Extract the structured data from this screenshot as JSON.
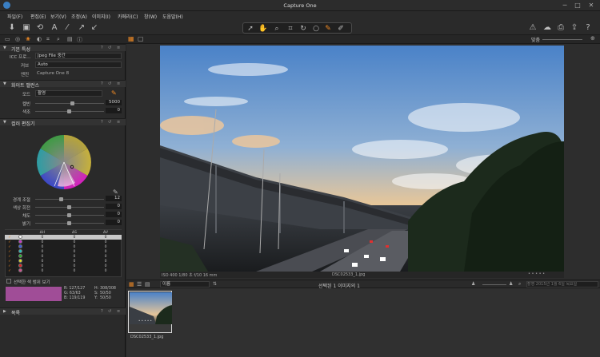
{
  "window": {
    "title": "Capture One",
    "min_glyph": "─",
    "max_glyph": "□",
    "close_glyph": "✕"
  },
  "menu": [
    "파일(F)",
    "편집(E)",
    "보기(V)",
    "조정(A)",
    "이미지(I)",
    "카메라(C)",
    "창(W)",
    "도움말(H)"
  ],
  "toolbar": {
    "fit_label": "맞춤"
  },
  "sections": {
    "basic": {
      "title": "기본 특성",
      "icc_label": "ICC 프로…",
      "icc_value": "Jpeg File 중간",
      "curve_label": "커브",
      "curve_value": "Auto",
      "engine_label": "엔진",
      "engine_value": "Capture One 8"
    },
    "wb": {
      "title": "화이트 밸런스",
      "mode_label": "모드",
      "mode_value": "촬영",
      "kelvin_label": "켈빈",
      "kelvin_value": "5000",
      "tint_label": "색조",
      "tint_value": "0"
    },
    "color_editor": {
      "title": "컬러 편집기",
      "smooth_label": "경계 조절",
      "smooth_value": "12",
      "hue_label": "색상 회전",
      "hue_value": "0",
      "sat_label": "채도",
      "sat_value": "0",
      "light_label": "밝기",
      "light_value": "0",
      "col_h": "ΔH",
      "col_s": "ΔS",
      "col_v": "ΔV",
      "rows": [
        {
          "color": "#ffffff",
          "h": "0",
          "s": "0",
          "v": "0"
        },
        {
          "color": "#c833c8",
          "h": "0",
          "s": "0",
          "v": "0"
        },
        {
          "color": "#3a5bd9",
          "h": "0",
          "s": "0",
          "v": "0"
        },
        {
          "color": "#22c0c0",
          "h": "0",
          "s": "0",
          "v": "0"
        },
        {
          "color": "#28b028",
          "h": "0",
          "s": "0",
          "v": "0"
        },
        {
          "color": "#e0e020",
          "h": "0",
          "s": "0",
          "v": "0"
        },
        {
          "color": "#e02020",
          "h": "0",
          "s": "0",
          "v": "0"
        },
        {
          "color": "#d05090",
          "h": "0",
          "s": "0",
          "v": "0"
        }
      ],
      "show_range_label": "선택한 색 범위 보기",
      "readout": {
        "r": "R:",
        "r_val": "127/127",
        "g": "G:",
        "g_val": "63/63",
        "b": "B:",
        "b_val": "119/119",
        "h": "H:",
        "h_val": "308/308",
        "s": "S:",
        "s_val": "50/50",
        "y": "Y:",
        "y_val": "50/50"
      },
      "swatch_color": "#a04d97"
    },
    "extra": {
      "title": "목록"
    }
  },
  "viewer": {
    "info": "ISO 400  1/80 초  f/10  16 mm",
    "filename": "DSC02533_1.jpg"
  },
  "browser": {
    "sort_value": "이름",
    "selection_text": "선택된 1 이미지의 1",
    "search_placeholder": "촬영 2015년 1월 6일 목요일",
    "thumbs": [
      {
        "filename": "DSC02533_1.jpg"
      }
    ]
  }
}
